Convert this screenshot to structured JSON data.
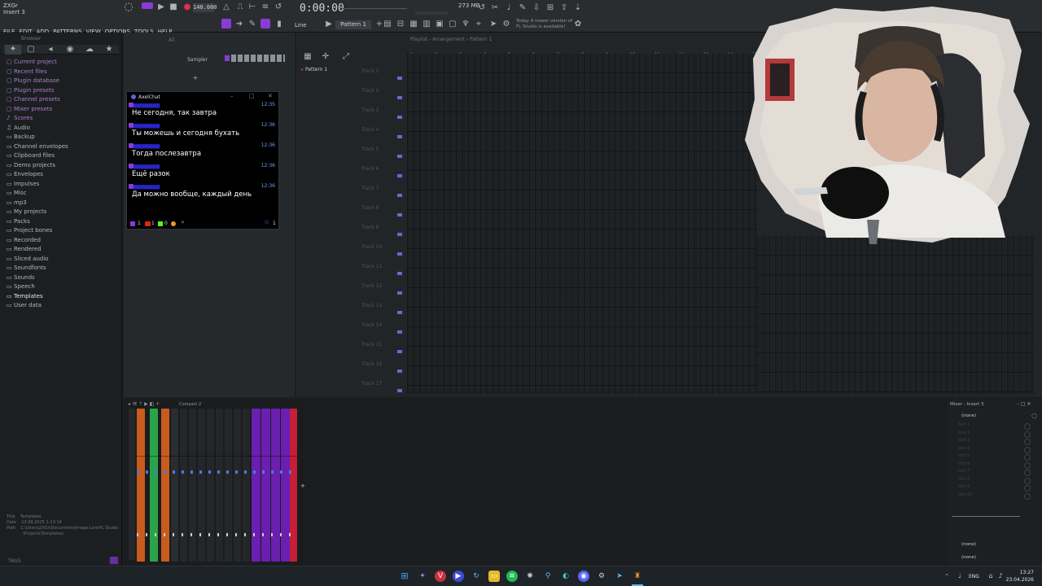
{
  "window": {
    "title_line1": "ZXGr",
    "title_line2": "Insert 3"
  },
  "menu": [
    "FILE",
    "EDIT",
    "ADD",
    "PATTERNS",
    "VIEW",
    "OPTIONS",
    "TOOLS",
    "HELP"
  ],
  "transport": {
    "tempo": "140.000",
    "time": "0:00:00",
    "cpu_mem": "273 MB",
    "pattern": "Pattern 1",
    "snap": "Line"
  },
  "news": {
    "line1": "Today   A newer version of",
    "line2": "FL Studio is available!"
  },
  "browser": {
    "header": "Browser",
    "filter": "All",
    "items": [
      {
        "label": "Current project",
        "icon": "▢",
        "kind": "special"
      },
      {
        "label": "Recent files",
        "icon": "▢",
        "kind": "special"
      },
      {
        "label": "Plugin database",
        "icon": "▢",
        "kind": "special"
      },
      {
        "label": "Plugin presets",
        "icon": "▢",
        "kind": "special"
      },
      {
        "label": "Channel presets",
        "icon": "▢",
        "kind": "special"
      },
      {
        "label": "Mixer presets",
        "icon": "▢",
        "kind": "special"
      },
      {
        "label": "Scores",
        "icon": "♪",
        "kind": "special"
      },
      {
        "label": "Audio",
        "icon": "♫",
        "kind": "folder"
      },
      {
        "label": "Backup",
        "icon": "▭",
        "kind": "folder"
      },
      {
        "label": "Channel envelopes",
        "icon": "▭",
        "kind": "folder"
      },
      {
        "label": "Clipboard files",
        "icon": "▭",
        "kind": "folder"
      },
      {
        "label": "Demo projects",
        "icon": "▭",
        "kind": "folder"
      },
      {
        "label": "Envelopes",
        "icon": "▭",
        "kind": "folder"
      },
      {
        "label": "Impulses",
        "icon": "▭",
        "kind": "folder"
      },
      {
        "label": "Misc",
        "icon": "▭",
        "kind": "folder"
      },
      {
        "label": "mp3",
        "icon": "▭",
        "kind": "folder"
      },
      {
        "label": "My projects",
        "icon": "▭",
        "kind": "folder"
      },
      {
        "label": "Packs",
        "icon": "▭",
        "kind": "folder"
      },
      {
        "label": "Project bones",
        "icon": "▭",
        "kind": "folder"
      },
      {
        "label": "Recorded",
        "icon": "▭",
        "kind": "folder"
      },
      {
        "label": "Rendered",
        "icon": "▭",
        "kind": "folder"
      },
      {
        "label": "Sliced audio",
        "icon": "▭",
        "kind": "folder"
      },
      {
        "label": "Soundfonts",
        "icon": "▭",
        "kind": "folder"
      },
      {
        "label": "Sounds",
        "icon": "▭",
        "kind": "folder"
      },
      {
        "label": "Speech",
        "icon": "▭",
        "kind": "folder"
      },
      {
        "label": "Templates",
        "icon": "▭",
        "kind": "selected"
      },
      {
        "label": "User data",
        "icon": "▭",
        "kind": "folder"
      }
    ],
    "info": {
      "title_label": "Title",
      "title": "Templates",
      "date_label": "Date",
      "date": "13.09.2025 1:23:14",
      "path_label": "Path",
      "path_line1": "C:\\Users\\ZXGr\\Documents\\Image-Line\\FL Studio",
      "path_line2": "\\Projects\\Templates\\"
    },
    "tags": "TAGS"
  },
  "channel_rack": {
    "all_label": "All",
    "sampler": "Sampler"
  },
  "chat": {
    "title": "AxelChat",
    "messages": [
      {
        "time": "12:35",
        "text": "Не сегодня, так завтра"
      },
      {
        "time": "12:36",
        "text": "Ты можешь и сегодня бухать"
      },
      {
        "time": "12:36",
        "text": "Тогда послезавтра"
      },
      {
        "time": "12:36",
        "text": "Ещё разок"
      },
      {
        "time": "12:36",
        "text": "Да можно вообще, каждый день"
      }
    ],
    "counts": {
      "twitch": "1",
      "youtube": "1",
      "kick": "0",
      "viewers": "1"
    }
  },
  "playlist": {
    "title": "Playlist - Arrangement › Pattern 1",
    "pattern_item": "Pattern 1",
    "tracks": [
      "Track 1",
      "Track 2",
      "Track 3",
      "Track 4",
      "Track 5",
      "Track 6",
      "Track 7",
      "Track 8",
      "Track 9",
      "Track 10",
      "Track 11",
      "Track 12",
      "Track 13",
      "Track 14",
      "Track 15",
      "Track 16",
      "Track 17"
    ],
    "ruler": [
      "1",
      "2",
      "3",
      "4",
      "5",
      "6",
      "7",
      "8",
      "9",
      "10",
      "11",
      "12",
      "13",
      "14",
      "15"
    ]
  },
  "mixer": {
    "title": "Compact 2",
    "insert_title": "Mixer - Insert 3",
    "slot_none": "(none)",
    "slots": [
      "Slot 1",
      "Slot 2",
      "Slot 3",
      "Slot 4",
      "Slot 5",
      "Slot 6",
      "Slot 7",
      "Slot 8",
      "Slot 9",
      "Slot 10"
    ],
    "send_none_1": "(none)",
    "send_none_2": "(none)"
  },
  "taskbar": {
    "lang": "ENG",
    "time": "13:27",
    "date": "23.04.2026"
  }
}
